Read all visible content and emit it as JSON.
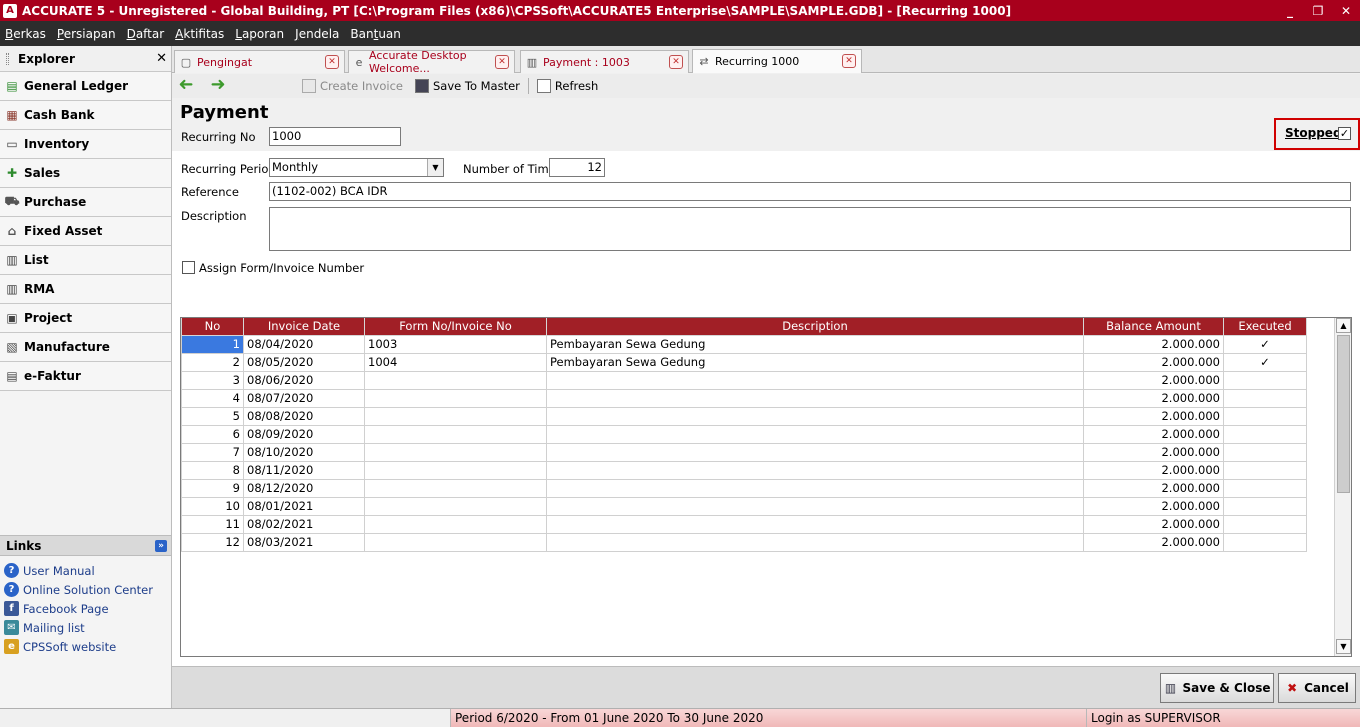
{
  "window": {
    "title": "ACCURATE 5  - Unregistered - Global Building, PT   [C:\\Program Files (x86)\\CPSSoft\\ACCURATE5 Enterprise\\SAMPLE\\SAMPLE.GDB] - [Recurring 1000]",
    "logo": "A",
    "minimize": "_",
    "restore": "❐",
    "close": "✕"
  },
  "menu": [
    {
      "pre": "",
      "ul": "B",
      "post": "erkas"
    },
    {
      "pre": "",
      "ul": "P",
      "post": "ersiapan"
    },
    {
      "pre": "",
      "ul": "D",
      "post": "aftar"
    },
    {
      "pre": "",
      "ul": "A",
      "post": "ktifitas"
    },
    {
      "pre": "",
      "ul": "L",
      "post": "aporan"
    },
    {
      "pre": "",
      "ul": "J",
      "post": "endela"
    },
    {
      "pre": "Ban",
      "ul": "t",
      "post": "uan"
    }
  ],
  "explorer": {
    "title": "Explorer",
    "close": "✕",
    "items": [
      {
        "label": "General Ledger",
        "icon": "ledger-icon",
        "glyph": "▤",
        "color": "#2e8b2e"
      },
      {
        "label": "Cash Bank",
        "icon": "cash-bank-icon",
        "glyph": "▦",
        "color": "#8b3a2e"
      },
      {
        "label": "Inventory",
        "icon": "inventory-icon",
        "glyph": "▭",
        "color": "#444444"
      },
      {
        "label": "Sales",
        "icon": "sales-icon",
        "glyph": "✚",
        "color": "#2e8b2e"
      },
      {
        "label": "Purchase",
        "icon": "cart-icon",
        "glyph": "⛟",
        "color": "#555555"
      },
      {
        "label": "Fixed Asset",
        "icon": "building-icon",
        "glyph": "⌂",
        "color": "#555555"
      },
      {
        "label": "List",
        "icon": "list-icon",
        "glyph": "▥",
        "color": "#444444"
      },
      {
        "label": "RMA",
        "icon": "rma-icon",
        "glyph": "▥",
        "color": "#444444"
      },
      {
        "label": "Project",
        "icon": "project-icon",
        "glyph": "▣",
        "color": "#444444"
      },
      {
        "label": "Manufacture",
        "icon": "manufacture-icon",
        "glyph": "▧",
        "color": "#444444"
      },
      {
        "label": "e-Faktur",
        "icon": "efaktur-icon",
        "glyph": "▤",
        "color": "#444444"
      }
    ]
  },
  "links": {
    "title": "Links",
    "collapse": "»",
    "items": [
      {
        "label": "User Manual",
        "glyph": "?",
        "color": "#2a63c8"
      },
      {
        "label": "Online Solution Center",
        "glyph": "?",
        "color": "#2a63c8"
      },
      {
        "label": "Facebook Page",
        "glyph": "f",
        "color": "#3b5998"
      },
      {
        "label": "Mailing list",
        "glyph": "✉",
        "color": "#3a8a9a"
      },
      {
        "label": "CPSSoft website",
        "glyph": "e",
        "color": "#d8a020"
      }
    ]
  },
  "tabs": [
    {
      "label": "Pengingat",
      "glyph": "▢"
    },
    {
      "label": "Accurate Desktop Welcome...",
      "glyph": "e"
    },
    {
      "label": "Payment : 1003",
      "glyph": "▥"
    },
    {
      "label": "Recurring 1000",
      "glyph": "⇄"
    }
  ],
  "tab_close": "✕",
  "toolbar": {
    "back": "➜",
    "forward": "➜",
    "create_invoice": "Create Invoice",
    "save_to_master": "Save To Master",
    "refresh": "Refresh"
  },
  "form": {
    "title": "Payment",
    "recurring_no_label": "Recurring No",
    "recurring_no": "1000",
    "stopped_label": "Stopped",
    "stopped_checked": "✓",
    "periode_label": "Recurring Perioda",
    "periode": "Monthly",
    "dropdown": "▼",
    "times_label": "Number of Times",
    "times": "12",
    "reference_label": "Reference",
    "reference": "(1102-002) BCA IDR",
    "description_label": "Description",
    "description": "",
    "assign_label": "Assign Form/Invoice Number"
  },
  "grid": {
    "columns": [
      "No",
      "Invoice Date",
      "Form No/Invoice No",
      "Description",
      "Balance Amount",
      "Executed"
    ],
    "rows": [
      {
        "no": "1",
        "date": "08/04/2020",
        "form_no": "1003",
        "desc": "Pembayaran Sewa Gedung",
        "amount": "2.000.000",
        "executed": "✓"
      },
      {
        "no": "2",
        "date": "08/05/2020",
        "form_no": "1004",
        "desc": "Pembayaran Sewa Gedung",
        "amount": "2.000.000",
        "executed": "✓"
      },
      {
        "no": "3",
        "date": "08/06/2020",
        "form_no": "",
        "desc": "",
        "amount": "2.000.000",
        "executed": ""
      },
      {
        "no": "4",
        "date": "08/07/2020",
        "form_no": "",
        "desc": "",
        "amount": "2.000.000",
        "executed": ""
      },
      {
        "no": "5",
        "date": "08/08/2020",
        "form_no": "",
        "desc": "",
        "amount": "2.000.000",
        "executed": ""
      },
      {
        "no": "6",
        "date": "08/09/2020",
        "form_no": "",
        "desc": "",
        "amount": "2.000.000",
        "executed": ""
      },
      {
        "no": "7",
        "date": "08/10/2020",
        "form_no": "",
        "desc": "",
        "amount": "2.000.000",
        "executed": ""
      },
      {
        "no": "8",
        "date": "08/11/2020",
        "form_no": "",
        "desc": "",
        "amount": "2.000.000",
        "executed": ""
      },
      {
        "no": "9",
        "date": "08/12/2020",
        "form_no": "",
        "desc": "",
        "amount": "2.000.000",
        "executed": ""
      },
      {
        "no": "10",
        "date": "08/01/2021",
        "form_no": "",
        "desc": "",
        "amount": "2.000.000",
        "executed": ""
      },
      {
        "no": "11",
        "date": "08/02/2021",
        "form_no": "",
        "desc": "",
        "amount": "2.000.000",
        "executed": ""
      },
      {
        "no": "12",
        "date": "08/03/2021",
        "form_no": "",
        "desc": "",
        "amount": "2.000.000",
        "executed": ""
      }
    ],
    "scroll_up": "▲",
    "scroll_down": "▼"
  },
  "buttons": {
    "save_close": "Save & Close",
    "cancel": "Cancel",
    "save_glyph": "▥",
    "cancel_glyph": "✖"
  },
  "status": {
    "period": "Period 6/2020 - From 01 June 2020 To 30 June 2020",
    "login": "Login as SUPERVISOR"
  },
  "colors": {
    "title_bar": "#a8001c",
    "grid_header": "#a11f26",
    "selection": "#3a79e0"
  }
}
